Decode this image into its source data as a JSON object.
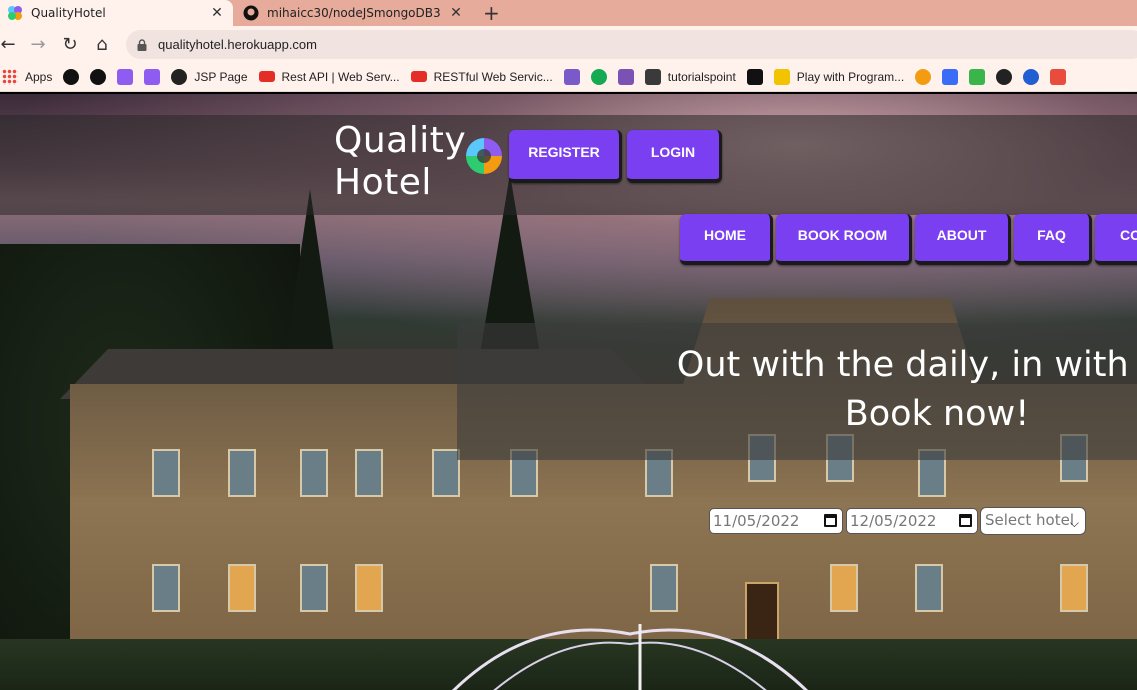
{
  "browser": {
    "tabs": [
      {
        "title": "QualityHotel",
        "active": true
      },
      {
        "title": "mihaicc30/nodeJSmongoDB3",
        "active": false
      }
    ],
    "new_tab_symbol": "+",
    "close_symbol": "✕",
    "url": "qualityhotel.herokuapp.com",
    "back_symbol": "←",
    "forward_symbol": "→",
    "reload_symbol": "↻",
    "home_symbol": "⌂",
    "bookmarks": [
      {
        "label": "Apps",
        "icon": "apps-grid-icon",
        "color": "#e8453c"
      },
      {
        "label": "",
        "icon": "github-icon",
        "color": "#111111"
      },
      {
        "label": "",
        "icon": "github-icon",
        "color": "#111111"
      },
      {
        "label": "",
        "icon": "hotel-logo-icon",
        "color": "#8e5cf0"
      },
      {
        "label": "",
        "icon": "hotel-logo-icon",
        "color": "#8e5cf0"
      },
      {
        "label": "JSP Page",
        "icon": "globe-icon",
        "color": "#222222"
      },
      {
        "label": "Rest API | Web Serv...",
        "icon": "youtube-icon",
        "color": "#e52d27"
      },
      {
        "label": "RESTful Web Servic...",
        "icon": "youtube-icon",
        "color": "#e52d27"
      },
      {
        "label": "",
        "icon": "heroku-icon",
        "color": "#7a5ac8"
      },
      {
        "label": "",
        "icon": "mongodb-icon",
        "color": "#13aa52"
      },
      {
        "label": "",
        "icon": "bootstrap-icon",
        "color": "#7952b3"
      },
      {
        "label": "tutorialspoint",
        "icon": "tutorialspoint-icon",
        "color": "#3a3a3a"
      },
      {
        "label": "",
        "icon": "notion-n-icon",
        "color": "#111111"
      },
      {
        "label": "Play with Program...",
        "icon": "play-program-icon",
        "color": "#f2c300"
      },
      {
        "label": "",
        "icon": "ring-icon",
        "color": "#f39c12"
      },
      {
        "label": "",
        "icon": "webflow-icon",
        "color": "#3b6cf5"
      },
      {
        "label": "",
        "icon": "green-square-icon",
        "color": "#39b54a"
      },
      {
        "label": "",
        "icon": "globe-icon",
        "color": "#222222"
      },
      {
        "label": "",
        "icon": "blue-circle-icon",
        "color": "#1f5fd1"
      },
      {
        "label": "",
        "icon": "calendar-badge-icon",
        "color": "#e94b3c"
      }
    ]
  },
  "site": {
    "logo_line1": "Quality",
    "logo_line2": "Hotel",
    "accent": "#7b3ff2",
    "auth_buttons": {
      "register": "REGISTER",
      "login": "LOGIN"
    },
    "nav": [
      {
        "label": "HOME"
      },
      {
        "label": "BOOK ROOM"
      },
      {
        "label": "ABOUT"
      },
      {
        "label": "FAQ"
      },
      {
        "label": "CO"
      }
    ],
    "hero_line1": "Out with the daily, in with the",
    "hero_line2": "Book now!",
    "booking": {
      "checkin_value": "11/05/2022",
      "checkout_value": "12/05/2022",
      "hotel_select": "Select hotel"
    }
  }
}
